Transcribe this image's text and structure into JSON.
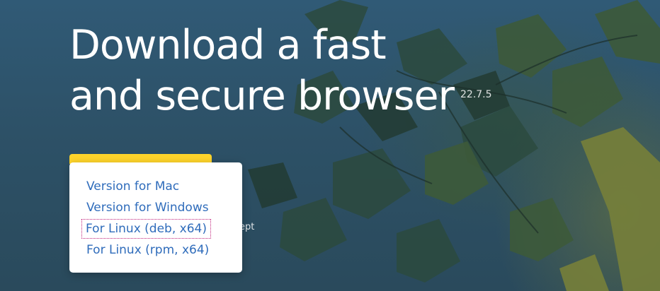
{
  "hero": {
    "headline_line1": "Download a fast",
    "headline_line2": "and secure browser",
    "version": "22.7.5"
  },
  "partial_text": "ept",
  "download_menu": {
    "items": [
      {
        "label": "Version for Mac",
        "focused": false
      },
      {
        "label": "Version for Windows",
        "focused": false
      },
      {
        "label": "For Linux (deb, x64)",
        "focused": true
      },
      {
        "label": "For Linux (rpm, x64)",
        "focused": false
      }
    ]
  },
  "colors": {
    "button_yellow": "#fed42b",
    "link_blue": "#2f6cbb",
    "focus_outline": "#c0207a"
  }
}
